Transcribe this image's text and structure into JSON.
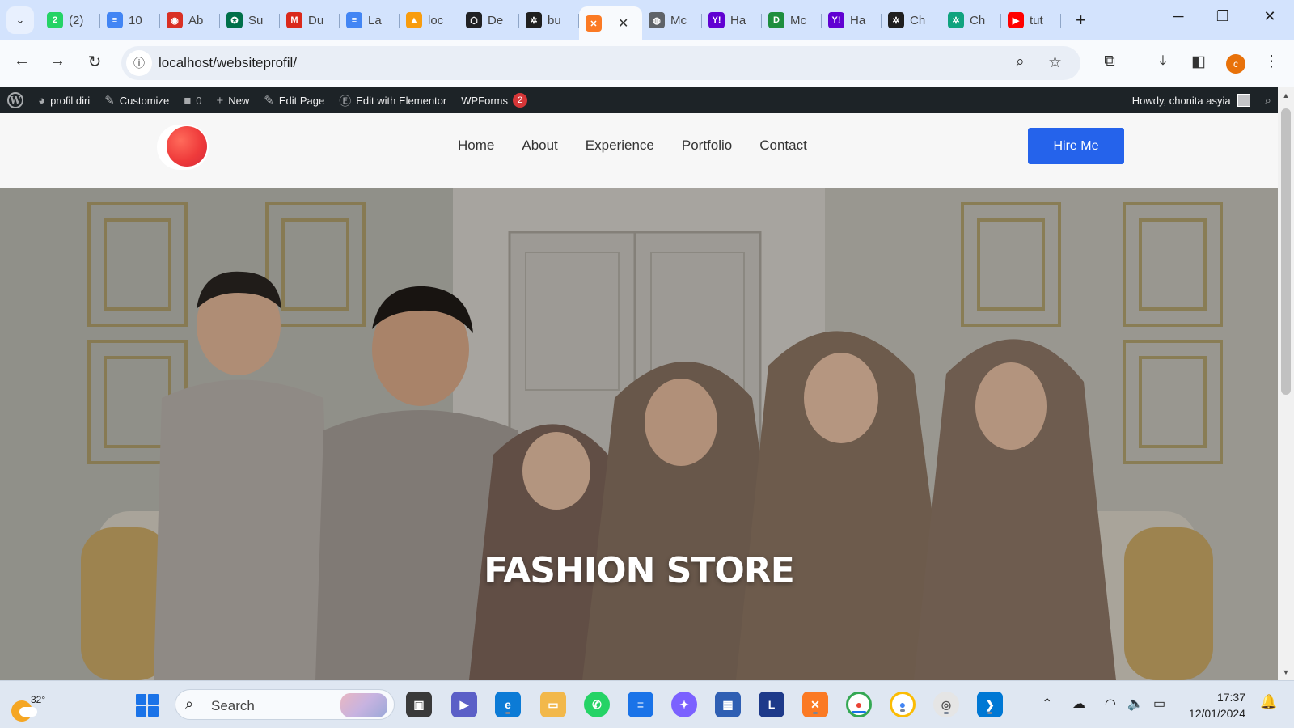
{
  "browser": {
    "tabs": [
      {
        "label": "(2)",
        "icon": "whatsapp-icon",
        "color": "#25d366",
        "glyph": "2"
      },
      {
        "label": "10",
        "icon": "google-docs-icon",
        "color": "#4285f4",
        "glyph": "≡"
      },
      {
        "label": "Ab",
        "icon": "web-icon",
        "color": "#d93025",
        "glyph": "◉"
      },
      {
        "label": "Su",
        "icon": "starbucks-icon",
        "color": "#00704a",
        "glyph": "✪"
      },
      {
        "label": "Du",
        "icon": "mcdonalds-icon",
        "color": "#da291c",
        "glyph": "M"
      },
      {
        "label": "La",
        "icon": "google-docs-icon",
        "color": "#4285f4",
        "glyph": "≡"
      },
      {
        "label": "loc",
        "icon": "phpmyadmin-icon",
        "color": "#f89c0e",
        "glyph": "▲"
      },
      {
        "label": "De",
        "icon": "codepen-icon",
        "color": "#202124",
        "glyph": "⬡"
      },
      {
        "label": "bu",
        "icon": "openai-icon",
        "color": "#1f1f1f",
        "glyph": "✲"
      },
      {
        "label": "",
        "icon": "xampp-icon",
        "color": "#fb7a24",
        "glyph": "✕",
        "active": true
      },
      {
        "label": "Mc",
        "icon": "globe-icon",
        "color": "#5f6368",
        "glyph": "◍"
      },
      {
        "label": "Ha",
        "icon": "yahoo-icon",
        "color": "#6001d2",
        "glyph": "Y!"
      },
      {
        "label": "Mc",
        "icon": "docs-green-icon",
        "color": "#1e8e3e",
        "glyph": "D"
      },
      {
        "label": "Ha",
        "icon": "yahoo-icon",
        "color": "#6001d2",
        "glyph": "Y!"
      },
      {
        "label": "Ch",
        "icon": "chatgpt-icon",
        "color": "#1f1f1f",
        "glyph": "✲"
      },
      {
        "label": "Ch",
        "icon": "chatgpt-icon",
        "color": "#10a37f",
        "glyph": "✲"
      },
      {
        "label": "tut",
        "icon": "youtube-icon",
        "color": "#ff0000",
        "glyph": "▶"
      }
    ],
    "url": "localhost/websiteprofil/",
    "profile_initial": "c"
  },
  "adminbar": {
    "site_name": "profil diri",
    "customize": "Customize",
    "comments_count": "0",
    "new_label": "New",
    "edit_page": "Edit Page",
    "edit_elementor": "Edit with Elementor",
    "wpforms": "WPForms",
    "wpforms_badge": "2",
    "howdy": "Howdy, chonita asyia"
  },
  "site": {
    "nav": [
      "Home",
      "About",
      "Experience",
      "Portfolio",
      "Contact"
    ],
    "cta_label": "Hire Me",
    "hero_title": "FASHION STORE",
    "colors": {
      "cta": "#2563eb",
      "logo": "#ef3b3b",
      "adminbar": "#1d2327"
    }
  },
  "taskbar": {
    "weather_temp": "32°",
    "search_label": "Search",
    "time": "17:37",
    "date": "12/01/2024"
  }
}
